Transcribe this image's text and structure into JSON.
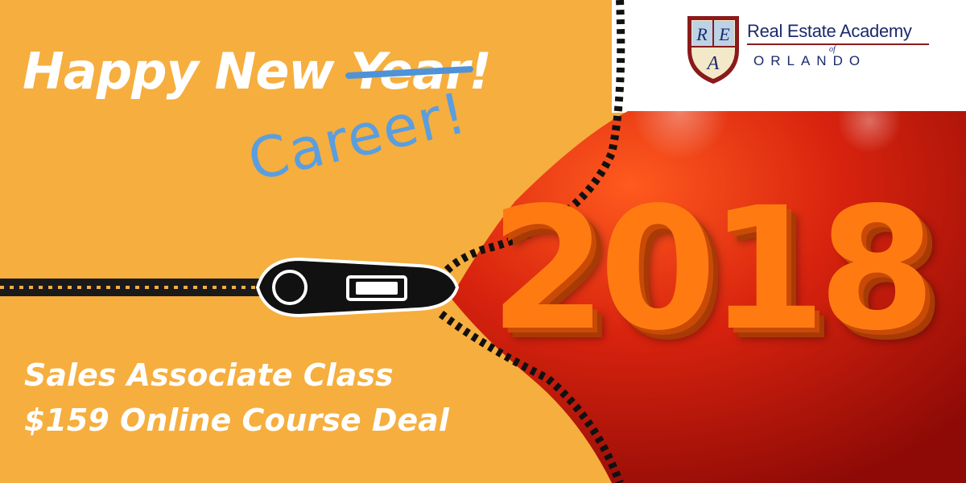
{
  "headline": {
    "prefix": "Happy New ",
    "struck_word": "Year",
    "suffix": "!"
  },
  "handwritten_word": "Career!",
  "big_year": "2018",
  "promo": {
    "line1": "Sales Associate Class",
    "line2": "$159 Online Course Deal"
  },
  "logo": {
    "name": "Real Estate Academy",
    "of": "of",
    "city": "ORLANDO",
    "crest_letters": [
      "R",
      "E",
      "A"
    ]
  },
  "colors": {
    "orange_bg": "#f6ae3e",
    "red_bg": "#c8170c",
    "year_orange": "#ff7b12",
    "handwriting_blue": "#5a9ee0",
    "logo_navy": "#1b2a6b",
    "logo_maroon": "#8b1a1a"
  }
}
